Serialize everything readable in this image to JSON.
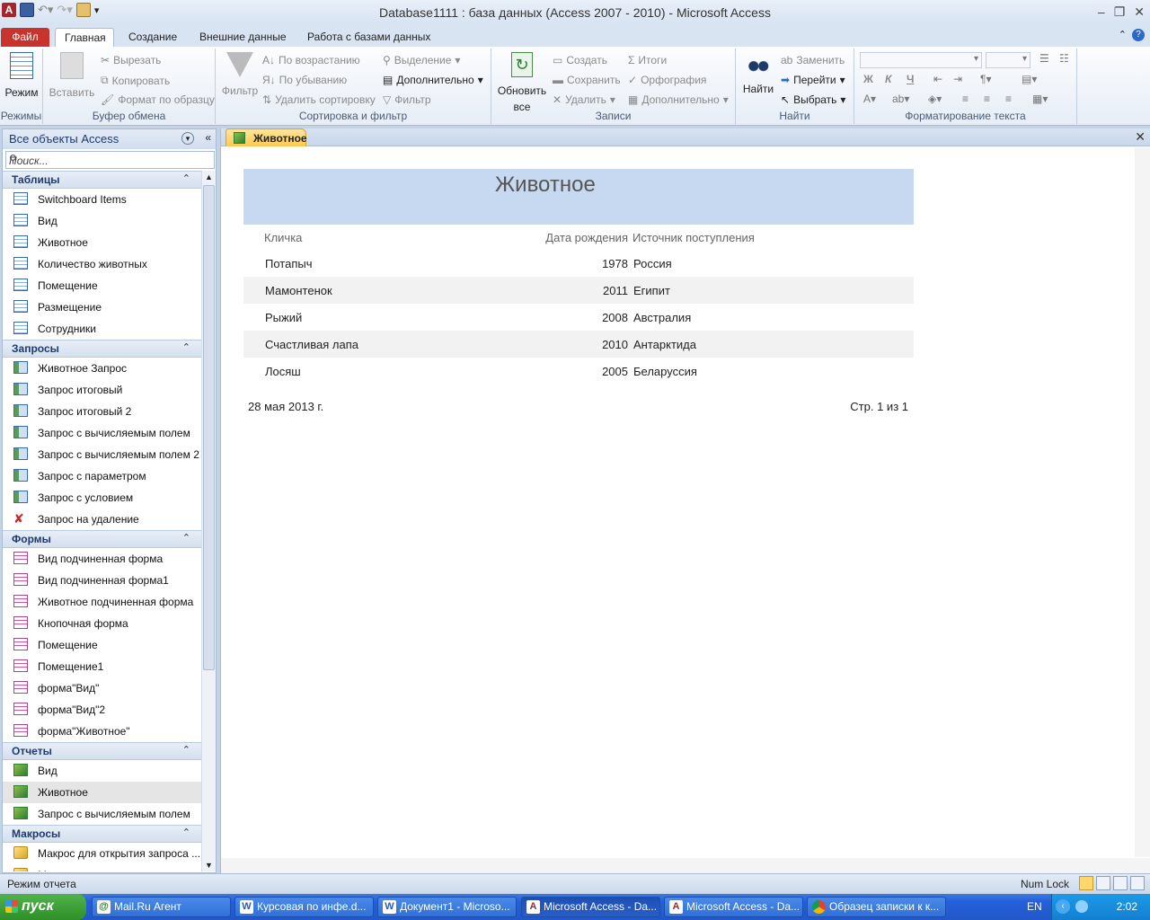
{
  "window": {
    "title": "Database1111 : база данных (Access 2007 - 2010)  -  Microsoft Access",
    "app_icon": "A"
  },
  "ribbon_tabs": [
    "Файл",
    "Главная",
    "Создание",
    "Внешние данные",
    "Работа с базами данных"
  ],
  "ribbon": {
    "views": {
      "mode": "Режим",
      "label": "Режимы"
    },
    "clipboard": {
      "paste": "Вставить",
      "cut": "Вырезать",
      "copy": "Копировать",
      "format_painter": "Формат по образцу",
      "label": "Буфер обмена"
    },
    "sort_filter": {
      "filter": "Фильтр",
      "asc": "По возрастанию",
      "desc": "По убыванию",
      "remove_sort": "Удалить сортировку",
      "selection": "Выделение",
      "advanced": "Дополнительно",
      "toggle_filter": "Фильтр",
      "label": "Сортировка и фильтр"
    },
    "records": {
      "refresh": "Обновить",
      "refresh2": "все",
      "new": "Создать",
      "save": "Сохранить",
      "delete": "Удалить",
      "totals": "Итоги",
      "spelling": "Орфография",
      "more": "Дополнительно",
      "label": "Записи"
    },
    "find": {
      "find": "Найти",
      "replace": "Заменить",
      "goto": "Перейти",
      "select": "Выбрать",
      "label": "Найти"
    },
    "text_format": {
      "bold": "Ж",
      "italic": "К",
      "underline": "Ч",
      "label": "Форматирование текста"
    }
  },
  "nav": {
    "title": "Все объекты Access",
    "search_placeholder": "Поиск...",
    "sections": [
      {
        "label": "Таблицы",
        "icon": "table-icon",
        "items": [
          "Switchboard Items",
          "Вид",
          "Животное",
          "Количество животных",
          "Помещение",
          "Размещение",
          "Сотрудники"
        ]
      },
      {
        "label": "Запросы",
        "icon": "query-icon",
        "items": [
          "Животное Запрос",
          "Запрос итоговый",
          "Запрос итоговый 2",
          "Запрос с вычисляемым полем",
          "Запрос с вычисляемым полем 2",
          "Запрос с параметром",
          "Запрос с условием",
          "Запрос на удаление"
        ]
      },
      {
        "label": "Формы",
        "icon": "form-icon",
        "items": [
          "Вид подчиненная форма",
          "Вид подчиненная форма1",
          "Животное подчиненная форма",
          "Кнопочная форма",
          "Помещение",
          "Помещение1",
          "форма\"Вид\"",
          "форма\"Вид\"2",
          "форма\"Животное\""
        ]
      },
      {
        "label": "Отчеты",
        "icon": "report-icon",
        "items": [
          "Вид",
          "Животное",
          "Запрос с вычисляемым полем"
        ]
      },
      {
        "label": "Макросы",
        "icon": "macro-icon",
        "items": [
          "Макрос для открытия запроса ...",
          "Макрос для открытия запроса ..."
        ]
      }
    ],
    "selected": "Животное"
  },
  "document": {
    "tab_label": "Животное",
    "report": {
      "title": "Животное",
      "columns": [
        "Кличка",
        "Дата рождения",
        "Источник поступления"
      ],
      "rows": [
        [
          "Потапыч",
          "1978",
          "Россия"
        ],
        [
          "Мамонтенок",
          "2011",
          "Египит"
        ],
        [
          "Рыжий",
          "2008",
          "Австралия"
        ],
        [
          "Счастливая лапа",
          "2010",
          "Антарктида"
        ],
        [
          "Лосяш",
          "2005",
          "Беларуссия"
        ]
      ],
      "footer_date": "28 мая 2013 г.",
      "footer_page": "Стр. 1 из 1"
    }
  },
  "status": {
    "mode": "Режим отчета",
    "numlock": "Num Lock"
  },
  "taskbar": {
    "start": "пуск",
    "tasks": [
      "Mail.Ru Агент",
      "Курсовая по инфе.d...",
      "Документ1 - Microso...",
      "Microsoft Access - Da...",
      "Microsoft Access - Da...",
      "Образец записки к к..."
    ],
    "lang": "EN",
    "clock": "2:02"
  }
}
